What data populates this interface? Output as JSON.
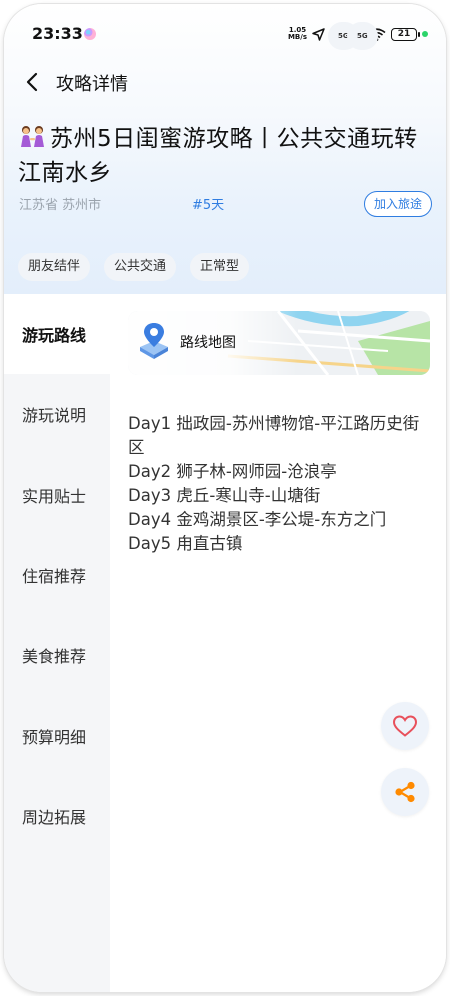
{
  "status_bar": {
    "time": "23:33",
    "net_speed_value": "1.05",
    "net_speed_unit": "MB/s",
    "sig1_tag": "5G",
    "sig2_tag": "5G",
    "battery": "21"
  },
  "nav": {
    "title": "攻略详情"
  },
  "guide": {
    "title": "苏州5日闺蜜游攻略丨公共交通玩转江南水乡",
    "location": "江苏省 苏州市",
    "days": "#5天",
    "add_trip_label": "加入旅途",
    "tags": [
      "朋友结伴",
      "公共交通",
      "正常型"
    ]
  },
  "sidebar": {
    "items": [
      "游玩路线",
      "游玩说明",
      "实用贴士",
      "住宿推荐",
      "美食推荐",
      "预算明细",
      "周边拓展"
    ],
    "active_index": 0
  },
  "route": {
    "map_label": "路线地图",
    "days": [
      "Day1 拙政园-苏州博物馆-平江路历史街区",
      "Day2 狮子林-网师园-沧浪亭",
      "Day3 虎丘-寒山寺-山塘街",
      "Day4 金鸡湖景区-李公堤-东方之门",
      "Day5 甪直古镇"
    ]
  },
  "colors": {
    "accent_blue": "#2f7de1",
    "like_red": "#e8505b",
    "share_orange": "#ff8a00"
  },
  "icons": {
    "back": "chevron-left-icon",
    "like": "heart-icon",
    "share": "share-icon",
    "map": "map-pin-icon"
  }
}
